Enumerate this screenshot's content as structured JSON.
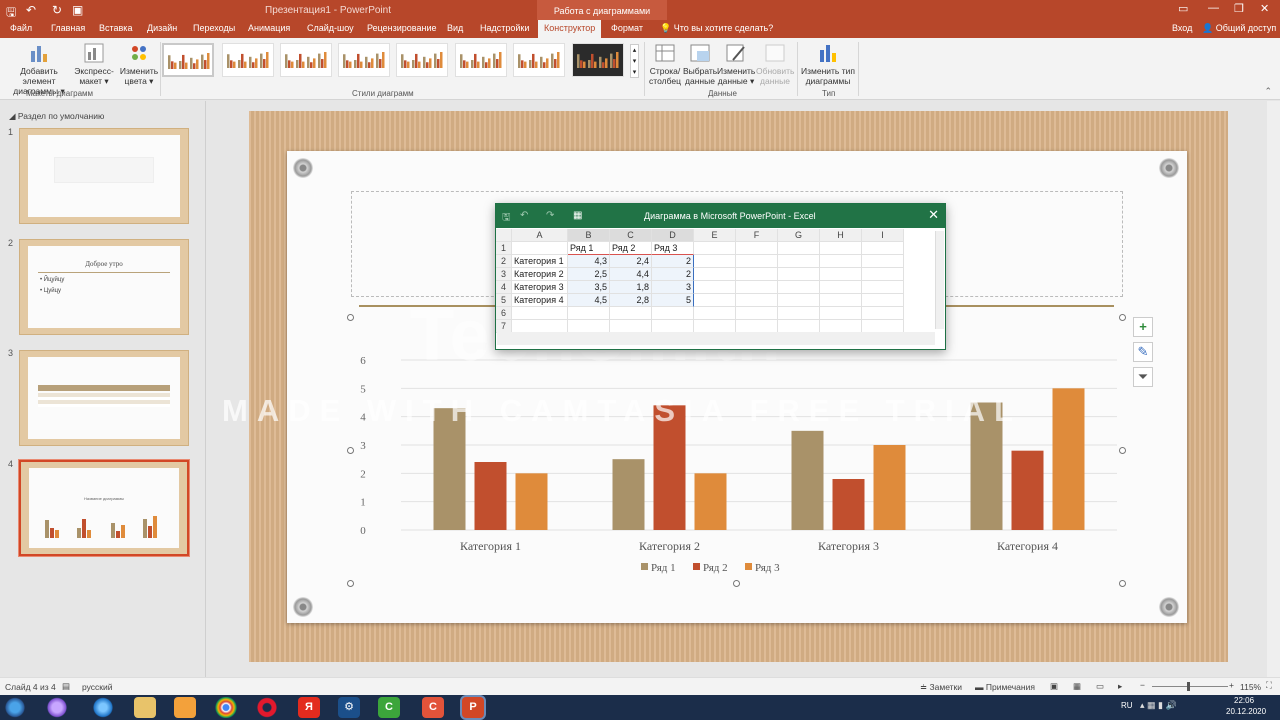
{
  "window": {
    "doc_title": "Презентация1 - PowerPoint",
    "context_title": "Работа с диаграммами"
  },
  "tabs": [
    "Файл",
    "Главная",
    "Вставка",
    "Дизайн",
    "Переходы",
    "Анимация",
    "Слайд-шоу",
    "Рецензирование",
    "Вид",
    "Надстройки",
    "Конструктор",
    "Формат"
  ],
  "tell_me": "Что вы хотите сделать?",
  "signin": "Вход",
  "share": "Общий доступ",
  "ribbon": {
    "add_element": "Добавить элемент диаграммы",
    "express_layout": "Экспресс-макет",
    "change_colors": "Изменить цвета",
    "group_layouts": "Макеты диаграмм",
    "group_styles": "Стили диаграмм",
    "switch_row_col": "Строка/ столбец",
    "select_data": "Выбрать данные",
    "edit_data": "Изменить данные",
    "refresh_data": "Обновить данные",
    "group_data": "Данные",
    "change_type": "Изменить тип диаграммы",
    "group_type": "Тип"
  },
  "slides_panel": {
    "section": "Раздел по умолчанию",
    "slide2_title": "Доброе утро",
    "slide2_bullets": [
      "Йцуйцу",
      "Цуйцу"
    ],
    "slide4_title": "Название диаграммы"
  },
  "excel": {
    "title": "Диаграмма в Microsoft PowerPoint - Excel",
    "columns": [
      "A",
      "B",
      "C",
      "D",
      "E",
      "F",
      "G",
      "H",
      "I"
    ],
    "headers": [
      "",
      "Ряд 1",
      "Ряд 2",
      "Ряд 3"
    ],
    "rows": [
      [
        "Категория 1",
        "4,3",
        "2,4",
        "2"
      ],
      [
        "Категория 2",
        "2,5",
        "4,4",
        "2"
      ],
      [
        "Категория 3",
        "3,5",
        "1,8",
        "3"
      ],
      [
        "Категория 4",
        "4,5",
        "2,8",
        "5"
      ]
    ]
  },
  "chart_data": {
    "type": "bar",
    "categories": [
      "Категория 1",
      "Категория 2",
      "Категория 3",
      "Категория 4"
    ],
    "series": [
      {
        "name": "Ряд 1",
        "values": [
          4.3,
          2.5,
          3.5,
          4.5
        ],
        "color": "#a99269"
      },
      {
        "name": "Ряд 2",
        "values": [
          2.4,
          4.4,
          1.8,
          2.8
        ],
        "color": "#c14f2e"
      },
      {
        "name": "Ряд 3",
        "values": [
          2,
          2,
          3,
          5
        ],
        "color": "#df8b3b"
      }
    ],
    "yticks": [
      "0",
      "1",
      "2",
      "3",
      "4",
      "5",
      "6"
    ],
    "ylim": [
      0,
      6
    ],
    "grid": true,
    "legend": "bottom"
  },
  "watermark": {
    "line1": "TechSmith",
    "line2": "MADE WITH CAMTASIA FREE TRIAL"
  },
  "status": {
    "slide": "Слайд 4 из 4",
    "lang": "русский",
    "notes": "Заметки",
    "comments": "Примечания",
    "zoom": "115%"
  },
  "taskbar": {
    "lang": "RU",
    "time": "22:06",
    "date": "20.12.2020"
  }
}
